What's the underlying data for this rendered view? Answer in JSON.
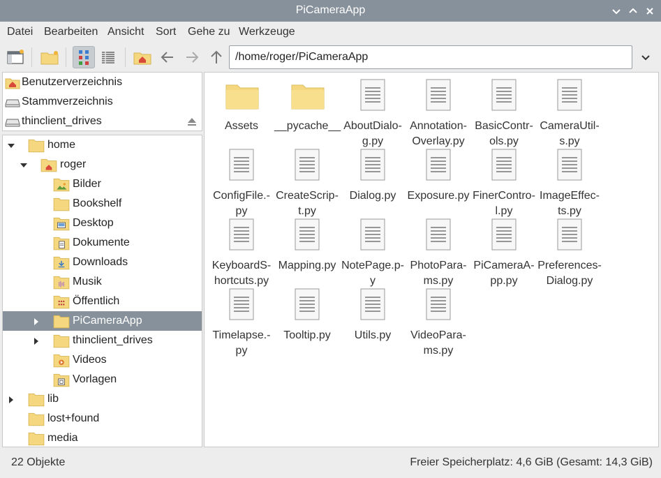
{
  "window": {
    "title": "PiCameraApp"
  },
  "menu": [
    "Datei",
    "Bearbeiten",
    "Ansicht",
    "Sort",
    "Gehe zu",
    "Werkzeuge"
  ],
  "address": {
    "path": "/home/roger/PiCameraApp"
  },
  "places": [
    {
      "label": "Benutzerverzeichnis",
      "icon": "home-icon"
    },
    {
      "label": "Stammverzeichnis",
      "icon": "drive-icon"
    },
    {
      "label": "thinclient_drives",
      "icon": "drive-icon"
    }
  ],
  "tree": [
    {
      "label": "home",
      "level": 0,
      "expander": "expanded",
      "icon": "folder-icon"
    },
    {
      "label": "roger",
      "level": 1,
      "expander": "expanded",
      "icon": "home-folder-icon"
    },
    {
      "label": "Bilder",
      "level": 2,
      "expander": "none",
      "icon": "pictures-folder-icon"
    },
    {
      "label": "Bookshelf",
      "level": 2,
      "expander": "none",
      "icon": "folder-icon"
    },
    {
      "label": "Desktop",
      "level": 2,
      "expander": "none",
      "icon": "desktop-folder-icon"
    },
    {
      "label": "Dokumente",
      "level": 2,
      "expander": "none",
      "icon": "documents-folder-icon"
    },
    {
      "label": "Downloads",
      "level": 2,
      "expander": "none",
      "icon": "downloads-folder-icon"
    },
    {
      "label": "Musik",
      "level": 2,
      "expander": "none",
      "icon": "music-folder-icon"
    },
    {
      "label": "Öffentlich",
      "level": 2,
      "expander": "none",
      "icon": "public-folder-icon"
    },
    {
      "label": "PiCameraApp",
      "level": 2,
      "expander": "collapsed",
      "icon": "folder-icon",
      "selected": true
    },
    {
      "label": "thinclient_drives",
      "level": 2,
      "expander": "collapsed",
      "icon": "folder-icon"
    },
    {
      "label": "Videos",
      "level": 2,
      "expander": "none",
      "icon": "videos-folder-icon"
    },
    {
      "label": "Vorlagen",
      "level": 2,
      "expander": "none",
      "icon": "templates-folder-icon"
    },
    {
      "label": "lib",
      "level": 0,
      "expander": "collapsed",
      "icon": "folder-icon"
    },
    {
      "label": "lost+found",
      "level": 0,
      "expander": "none",
      "icon": "folder-icon"
    },
    {
      "label": "media",
      "level": 0,
      "expander": "none",
      "icon": "folder-icon"
    }
  ],
  "files": [
    {
      "lines": [
        "Assets"
      ],
      "type": "folder"
    },
    {
      "lines": [
        "__pycache__"
      ],
      "type": "folder"
    },
    {
      "lines": [
        "AboutDialo-",
        "g.py"
      ],
      "type": "file"
    },
    {
      "lines": [
        "Annotation-",
        "Overlay.py"
      ],
      "type": "file"
    },
    {
      "lines": [
        "BasicContr-",
        "ols.py"
      ],
      "type": "file"
    },
    {
      "lines": [
        "CameraUtil-",
        "s.py"
      ],
      "type": "file"
    },
    {
      "lines": [
        "ConfigFile.-",
        "py"
      ],
      "type": "file"
    },
    {
      "lines": [
        "CreateScrip-",
        "t.py"
      ],
      "type": "file"
    },
    {
      "lines": [
        "Dialog.py"
      ],
      "type": "file"
    },
    {
      "lines": [
        "Exposure.py"
      ],
      "type": "file"
    },
    {
      "lines": [
        "FinerContro-",
        "l.py"
      ],
      "type": "file"
    },
    {
      "lines": [
        "ImageEffec-",
        "ts.py"
      ],
      "type": "file"
    },
    {
      "lines": [
        "KeyboardS-",
        "hortcuts.py"
      ],
      "type": "file"
    },
    {
      "lines": [
        "Mapping.py"
      ],
      "type": "file"
    },
    {
      "lines": [
        "NotePage.p-",
        "y"
      ],
      "type": "file"
    },
    {
      "lines": [
        "PhotoPara-",
        "ms.py"
      ],
      "type": "file"
    },
    {
      "lines": [
        "PiCameraA-",
        "pp.py"
      ],
      "type": "file"
    },
    {
      "lines": [
        "Preferences-",
        "Dialog.py"
      ],
      "type": "file"
    },
    {
      "lines": [
        "Timelapse.-",
        "py"
      ],
      "type": "file"
    },
    {
      "lines": [
        "Tooltip.py"
      ],
      "type": "file"
    },
    {
      "lines": [
        "Utils.py"
      ],
      "type": "file"
    },
    {
      "lines": [
        "VideoPara-",
        "ms.py"
      ],
      "type": "file"
    }
  ],
  "status": {
    "count": "22 Objekte",
    "space": "Freier Speicherplatz: 4,6 GiB (Gesamt: 14,3 GiB)"
  },
  "colors": {
    "titlebar": "#87919b",
    "selection": "#87919b",
    "folder": "#f5d780",
    "folder_dark": "#e8c55e"
  }
}
